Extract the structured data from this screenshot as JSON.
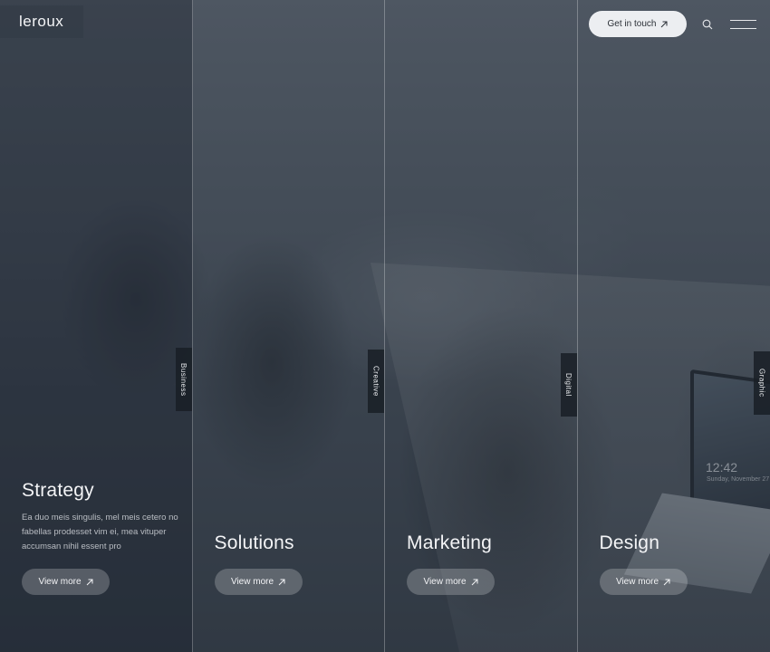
{
  "header": {
    "logo": "leroux",
    "cta_label": "Get in touch",
    "icons": {
      "cta": "arrow-up-right-icon",
      "search": "search-icon",
      "menu": "hamburger-menu-icon"
    }
  },
  "columns": [
    {
      "tab": "Business",
      "title": "Strategy",
      "description": "Ea duo meis singulis, mel meis cetero no fabellas prodesset vim ei, mea vituper accumsan nihil essent pro",
      "button": "View more",
      "active": true
    },
    {
      "tab": "Creative",
      "title": "Solutions",
      "description": "",
      "button": "View more",
      "active": false
    },
    {
      "tab": "Digital",
      "title": "Marketing",
      "description": "",
      "button": "View more",
      "active": false
    },
    {
      "tab": "Graphic",
      "title": "Design",
      "description": "",
      "button": "View more",
      "active": false
    }
  ],
  "photo": {
    "laptop_clock": "12:42",
    "laptop_date": "Sunday, November 27"
  },
  "colors": {
    "overlay": "#262e3a",
    "cta_bg": "#eceef1",
    "text": "#f3f4f6"
  }
}
